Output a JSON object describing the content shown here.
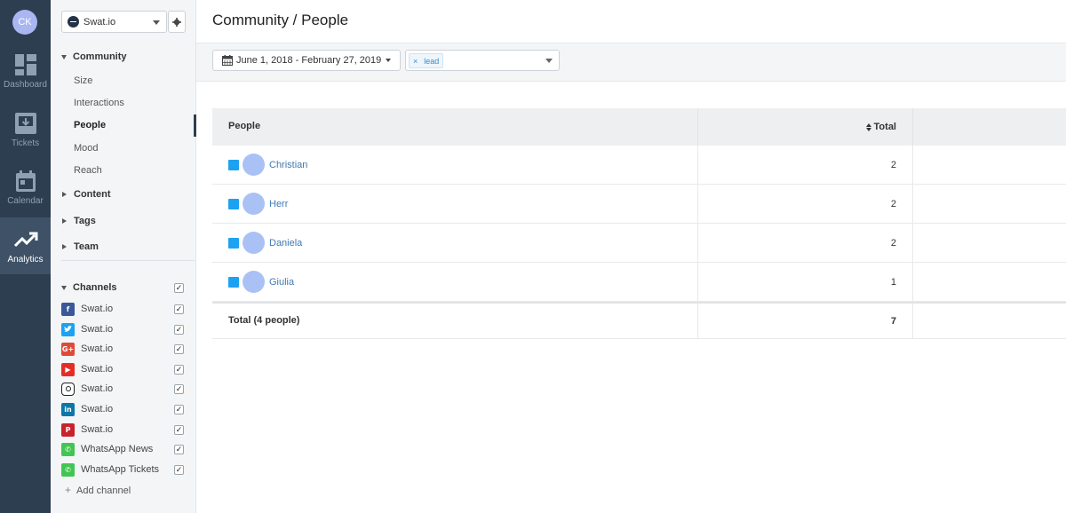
{
  "rail": {
    "user_initials": "CK",
    "items": [
      {
        "label": "Dashboard",
        "icon": "dashboard-icon"
      },
      {
        "label": "Tickets",
        "icon": "tickets-icon"
      },
      {
        "label": "Calendar",
        "icon": "calendar-icon"
      },
      {
        "label": "Analytics",
        "icon": "analytics-icon",
        "active": true
      }
    ]
  },
  "sidebar": {
    "account": "Swat.io",
    "community": {
      "label": "Community",
      "items": [
        "Size",
        "Interactions",
        "People",
        "Mood",
        "Reach"
      ],
      "active": "People"
    },
    "collapsed_sections": [
      "Content",
      "Tags",
      "Team"
    ],
    "channels": {
      "label": "Channels",
      "items": [
        {
          "name": "Swat.io",
          "network": "facebook",
          "color": "#3b5998"
        },
        {
          "name": "Swat.io",
          "network": "twitter",
          "color": "#1da1f2"
        },
        {
          "name": "Swat.io",
          "network": "google-plus",
          "color": "#dd4b39"
        },
        {
          "name": "Swat.io",
          "network": "youtube",
          "color": "#e52d27"
        },
        {
          "name": "Swat.io",
          "network": "instagram",
          "color": "#222222"
        },
        {
          "name": "Swat.io",
          "network": "linkedin",
          "color": "#0e76a8"
        },
        {
          "name": "Swat.io",
          "network": "pinterest",
          "color": "#c8232c"
        },
        {
          "name": "WhatsApp News",
          "network": "whatsapp",
          "color": "#43c553"
        },
        {
          "name": "WhatsApp Tickets",
          "network": "whatsapp",
          "color": "#43c553"
        }
      ]
    },
    "add_channel": "Add channel"
  },
  "main": {
    "title": "Community / People",
    "date_range": "June 1, 2018 - February 27, 2019",
    "tag_filter": "lead",
    "table": {
      "col_people": "People",
      "col_total": "Total",
      "rows": [
        {
          "name": "Christian",
          "total": "2"
        },
        {
          "name": "Herr",
          "total": "2"
        },
        {
          "name": "Daniela",
          "total": "2"
        },
        {
          "name": "Giulia",
          "total": "1"
        }
      ],
      "total_label": "Total (4 people)",
      "total_value": "7"
    }
  }
}
